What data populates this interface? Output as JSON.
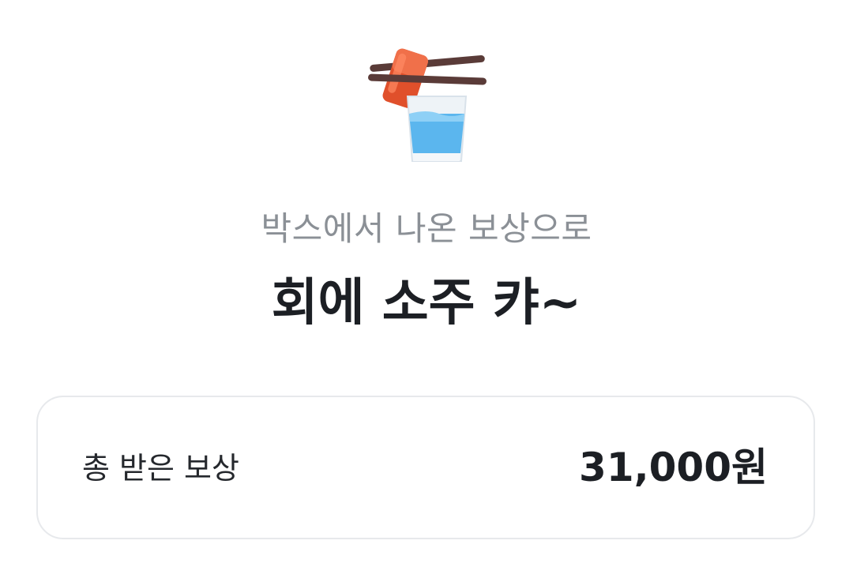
{
  "header": {
    "illustration_icon": "sashimi-and-soju-glass-icon",
    "subtitle": "박스에서 나온 보상으로",
    "title": "회에 소주 캬~"
  },
  "reward_card": {
    "label": "총 받은 보상",
    "value": "31,000원"
  }
}
